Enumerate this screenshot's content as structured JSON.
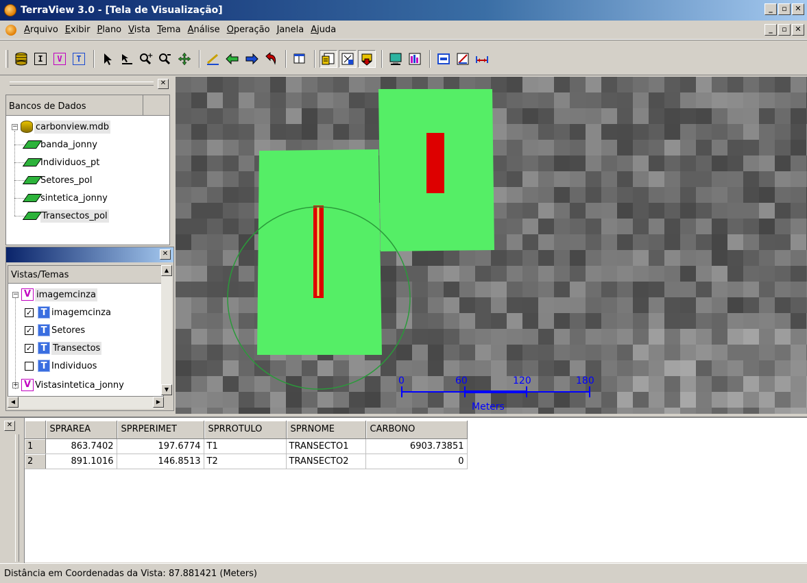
{
  "window": {
    "title": "TerraView 3.0 - [Tela de Visualização]"
  },
  "menu": {
    "items": [
      "Arquivo",
      "Exibir",
      "Plano",
      "Vista",
      "Tema",
      "Análise",
      "Operação",
      "Janela",
      "Ajuda"
    ]
  },
  "toolbar": {
    "letters": [
      "I",
      "V",
      "T"
    ],
    "icons": [
      "database-icon",
      "info-letter",
      "view-letter",
      "theme-letter",
      "pointer-icon",
      "info-tool-icon",
      "zoom-in-icon",
      "zoom-out-icon",
      "pan-icon",
      "draw-line-icon",
      "back-arrow-icon",
      "forward-arrow-icon",
      "undo-icon",
      "table-icon",
      "query-icon",
      "grid-icon",
      "export-icon",
      "display-icon",
      "chart-icon",
      "legend-icon",
      "edit-icon",
      "measure-icon"
    ]
  },
  "database_tree": {
    "header": "Bancos de Dados",
    "database": "carbonview.mdb",
    "layers": [
      "banda_jonny",
      "Individuos_pt",
      "Setores_pol",
      "sintetica_jonny",
      "Transectos_pol"
    ]
  },
  "views_tree": {
    "header": "Vistas/Temas",
    "views": [
      {
        "name": "imagemcinza",
        "themes": [
          {
            "name": "imagemcinza",
            "checked": true
          },
          {
            "name": "Setores",
            "checked": true
          },
          {
            "name": "Transectos",
            "checked": true
          },
          {
            "name": "Individuos",
            "checked": false
          }
        ]
      },
      {
        "name": "Vistasintetica_jonny",
        "themes": []
      }
    ]
  },
  "map": {
    "scale_ticks": [
      "0",
      "60",
      "120",
      "180"
    ],
    "scale_unit": "Meters",
    "colors": {
      "sector": "#55ee66",
      "transect": "#dd0000",
      "scale": "#0000ff",
      "circle": "#2a9a3a"
    }
  },
  "table": {
    "columns": [
      "SPRAREA",
      "SPRPERIMET",
      "SPRROTULO",
      "SPRNOME",
      "CARBONO"
    ],
    "rows": [
      {
        "n": "1",
        "cells": [
          "863.7402",
          "197.6774",
          "T1",
          "TRANSECTO1",
          "6903.73851"
        ]
      },
      {
        "n": "2",
        "cells": [
          "891.1016",
          "146.8513",
          "T2",
          "TRANSECTO2",
          "0"
        ]
      }
    ]
  },
  "status": {
    "text": "Distância em Coordenadas da Vista: 87.881421 (Meters)"
  }
}
